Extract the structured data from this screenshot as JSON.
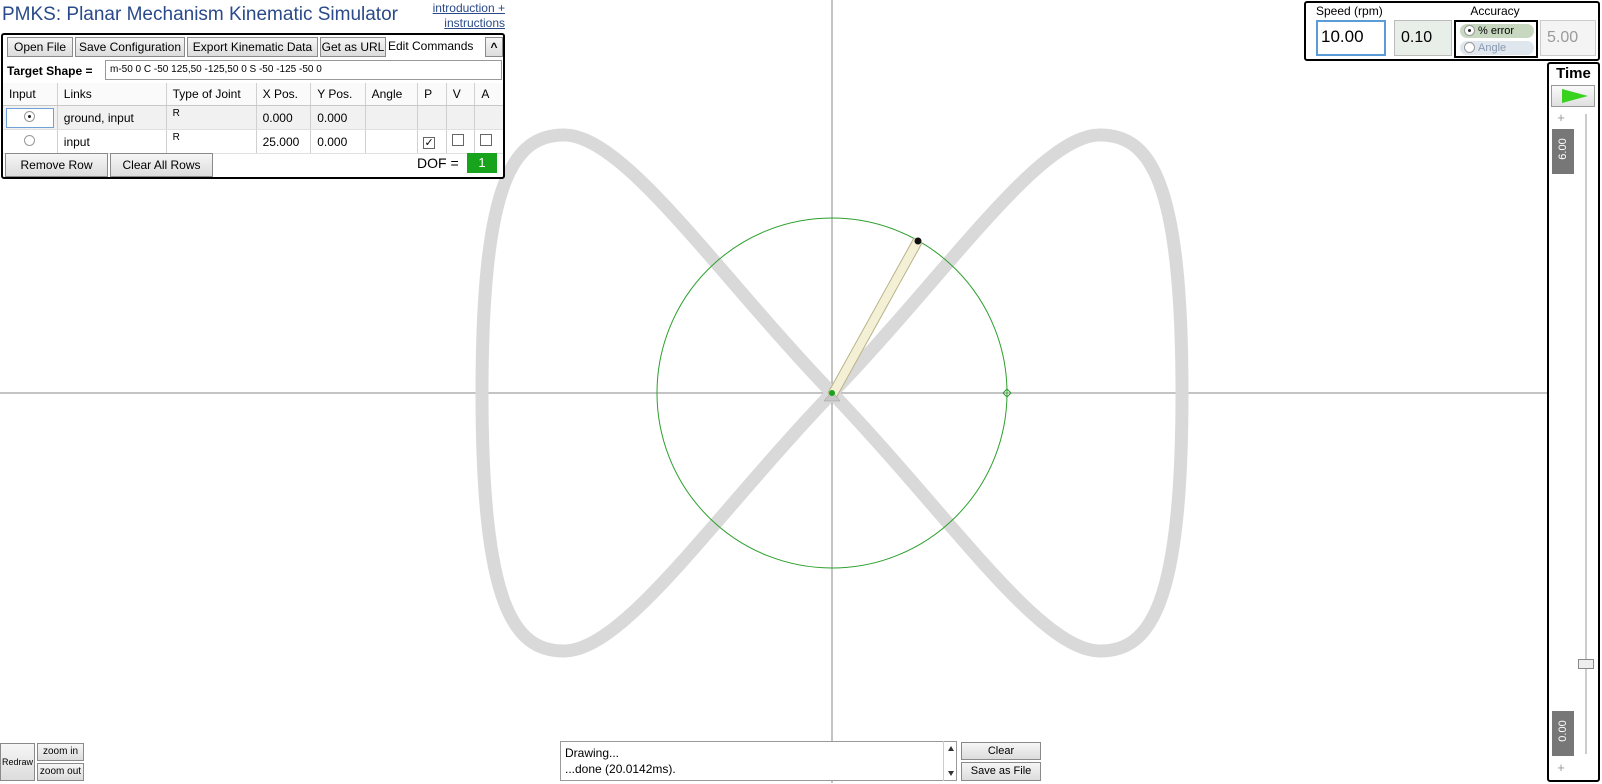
{
  "app": {
    "title": "PMKS: Planar Mechanism Kinematic Simulator",
    "intro_line1": "introduction +",
    "intro_line2": "instructions"
  },
  "toolbar": {
    "open_file": "Open File",
    "save_config": "Save Configuration",
    "export_data": "Export Kinematic Data",
    "get_url": "Get as URL",
    "edit_commands": "Edit Commands",
    "collapse_glyph": "^"
  },
  "target_shape": {
    "label": "Target Shape =",
    "value": "m-50 0 C -50 125,50 -125,50 0 S -50 -125 -50 0"
  },
  "table": {
    "headers": [
      "Input",
      "Links",
      "Type of Joint",
      "X Pos.",
      "Y Pos.",
      "Angle",
      "P",
      "V",
      "A"
    ],
    "rows": [
      {
        "input_selected": true,
        "links": "ground, input",
        "joint": "R",
        "x": "0.000",
        "y": "0.000",
        "angle": "",
        "p": null,
        "v": null,
        "a": null
      },
      {
        "input_selected": false,
        "links": "input",
        "joint": "R",
        "x": "25.000",
        "y": "0.000",
        "angle": "",
        "p": true,
        "v": false,
        "a": false
      }
    ]
  },
  "footer": {
    "remove_row": "Remove Row",
    "clear_rows": "Clear All Rows",
    "dof_label": "DOF =",
    "dof_value": "1"
  },
  "speed": {
    "label": "Speed (rpm)",
    "value": "10.00",
    "accuracy_label": "Accuracy",
    "accuracy_value": "0.10",
    "error_option": "% error",
    "angle_option": "Angle",
    "angle_value": "5.00"
  },
  "time": {
    "label": "Time",
    "max": "6.00",
    "min": "0.00",
    "plus_top": "+",
    "plus_bottom": "+",
    "current_fraction": 0.14
  },
  "view": {
    "redraw": "Redraw",
    "zoom_in": "zoom in",
    "zoom_out": "zoom out"
  },
  "console": {
    "line1": "Drawing...",
    "line2": "...done (20.0142ms).",
    "clear": "Clear",
    "save": "Save as File"
  },
  "colors": {
    "accent_green": "#17a31b",
    "title_blue": "#2a4a8a",
    "path_gray": "#d9d9d9",
    "circle_green": "#2ea02e",
    "link_fill": "#f3f0d6"
  }
}
